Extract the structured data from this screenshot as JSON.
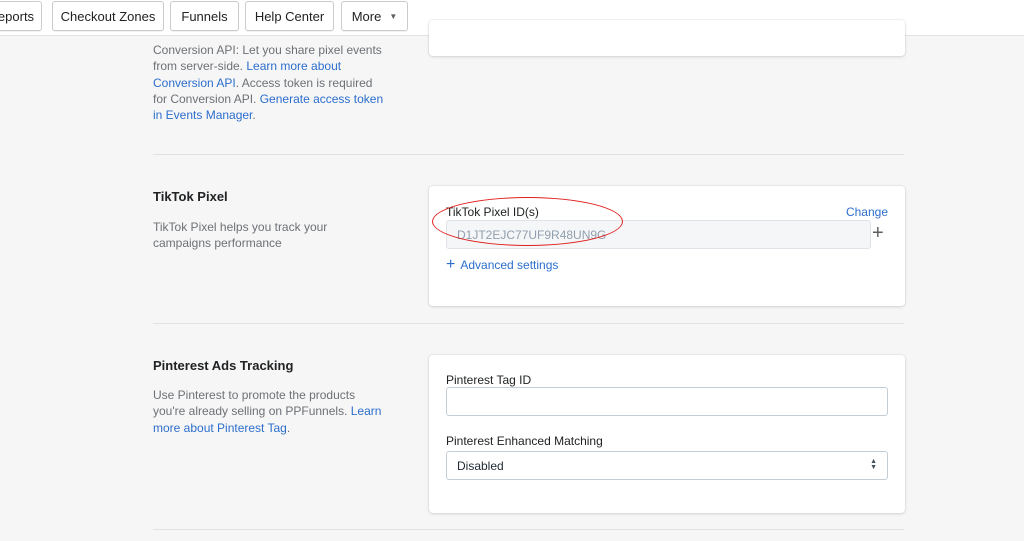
{
  "nav": {
    "items": [
      {
        "label": "eports"
      },
      {
        "label": "Checkout Zones"
      },
      {
        "label": "Funnels"
      },
      {
        "label": "Help Center"
      },
      {
        "label": "More",
        "icon": "caret-down-icon"
      }
    ]
  },
  "conversion_api": {
    "desc_1": "Conversion API: Let you share pixel events from server-side. ",
    "link_1": "Learn more about Conversion API",
    "desc_2": ". Access token is required for Conversion API. ",
    "link_2": "Generate access token in Events Manager",
    "desc_3": "."
  },
  "tiktok": {
    "title": "TikTok Pixel",
    "description": "TikTok Pixel helps you track your campaigns performance",
    "field_label": "TikTok Pixel ID(s)",
    "change_label": "Change",
    "pixel_id": "D1JT2EJC77UF9R48UN9G",
    "add_icon": "plus-icon",
    "advanced_icon": "plus-icon",
    "advanced_label": "Advanced settings"
  },
  "pinterest": {
    "title": "Pinterest Ads Tracking",
    "desc_1": "Use Pinterest to promote the products you're already selling on PPFunnels. ",
    "link_1": "Learn more about Pinterest Tag",
    "desc_2": ".",
    "tag_id_label": "Pinterest Tag ID",
    "tag_id_value": "",
    "matching_label": "Pinterest Enhanced Matching",
    "matching_value": "Disabled"
  },
  "colors": {
    "link": "#2c6ecb",
    "annotation": "#e0201e",
    "background": "#f6f6f7"
  }
}
